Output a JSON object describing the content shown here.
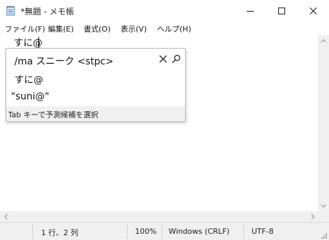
{
  "window": {
    "title": "*無題 - メモ帳",
    "icon": "notepad-icon",
    "controls": {
      "minimize": "minimize-icon",
      "maximize": "maximize-icon",
      "close": "close-icon"
    }
  },
  "menu": {
    "items": [
      {
        "label": "ファイル(F)"
      },
      {
        "label": "編集(E)"
      },
      {
        "label": "書式(O)"
      },
      {
        "label": "表示(V)"
      },
      {
        "label": "ヘルプ(H)"
      }
    ]
  },
  "editor": {
    "text": "すに@"
  },
  "ime_popup": {
    "candidates": [
      {
        "text": "/ma スニーク <stpc>"
      },
      {
        "text": "すに@"
      },
      {
        "text": "\"suni@\""
      }
    ],
    "close_icon": "close-icon",
    "search_icon": "search-icon",
    "hint": "Tab キーで予測候補を選択"
  },
  "statusbar": {
    "position": "1 行、2 列",
    "zoom": "100%",
    "line_ending": "Windows (CRLF)",
    "encoding": "UTF-8"
  }
}
